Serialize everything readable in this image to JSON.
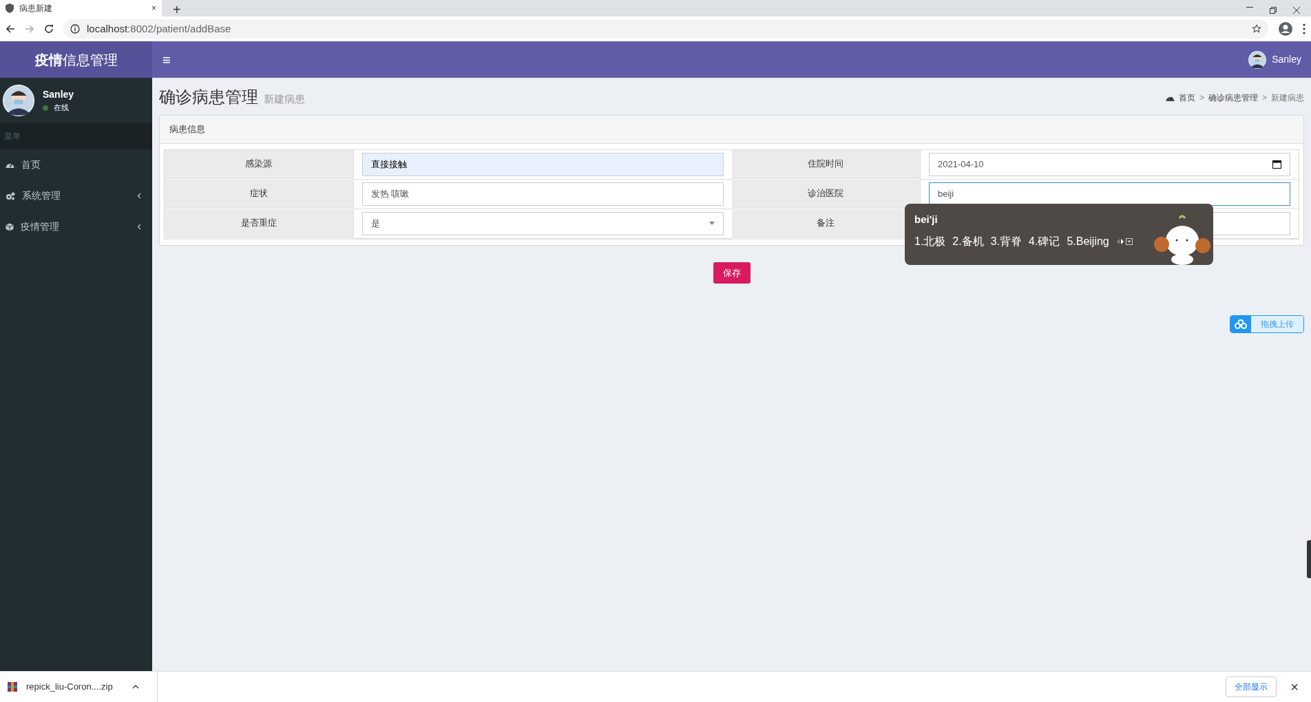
{
  "browser": {
    "tab_title": "病患新建",
    "new_tab": "+",
    "close_tab": "×",
    "url_host": "localhost",
    "url_path": ":8002/patient/addBase"
  },
  "app": {
    "logo": "**疫情**信息管理",
    "menu_toggle": "≡",
    "header_user": "Sanley"
  },
  "sidebar": {
    "user": "Sanley",
    "status": "在线",
    "menu_header": "菜单",
    "items": [
      {
        "label": "首页",
        "has_submenu": false
      },
      {
        "label": "系统管理",
        "has_submenu": true
      },
      {
        "label": "疫情管理",
        "has_submenu": true
      }
    ]
  },
  "page": {
    "title": "确诊病患管理",
    "subtitle": "新建病患",
    "breadcrumb": [
      {
        "label": "首页",
        "current": false
      },
      {
        "label": "确诊病患管理",
        "current": false
      },
      {
        "label": "新建病患",
        "current": true
      }
    ],
    "breadcrumb_separator": ">"
  },
  "card": {
    "title": "病患信息",
    "fields": [
      {
        "label": "感染源",
        "kind": "text",
        "value": "直接接触",
        "autofilled": true,
        "focused": false
      },
      {
        "label": "住院时间",
        "kind": "date",
        "value": "2021-04-10",
        "autofilled": false,
        "focused": false
      },
      {
        "label": "症状",
        "kind": "text",
        "value": "发热 咳嗽",
        "autofilled": false,
        "focused": false
      },
      {
        "label": "诊治医院",
        "kind": "text",
        "value": "beiji",
        "autofilled": false,
        "focused": true
      },
      {
        "label": "是否重症",
        "kind": "select",
        "value": "是",
        "autofilled": false,
        "focused": false
      },
      {
        "label": "备注",
        "kind": "text",
        "autofilled": false,
        "focused": false
      }
    ]
  },
  "save_button": "保存",
  "upload_widget": {
    "label": "拖拽上传"
  },
  "ime": {
    "composition": "bei'ji",
    "candidates": [
      "1.北极",
      "2.备机",
      "3.背脊",
      "4.碑记",
      "5.Beijing"
    ]
  },
  "download_bar": {
    "filename": "repick_liu-Coron....zip",
    "show_all": "全部显示",
    "close": "×"
  }
}
